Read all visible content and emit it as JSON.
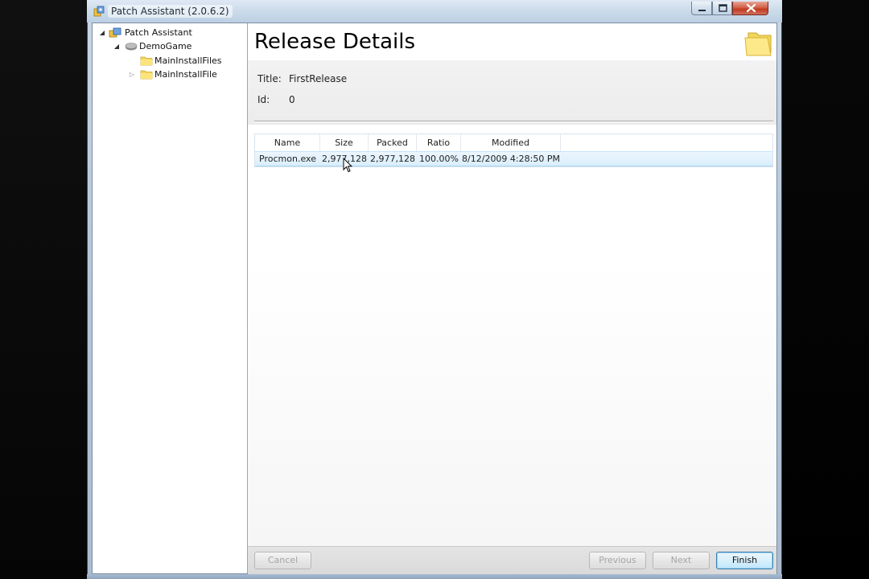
{
  "window": {
    "title": "Patch Assistant (2.0.6.2)"
  },
  "tree": {
    "items": [
      {
        "label": "Patch Assistant",
        "icon": "app-icon",
        "expanded": true
      },
      {
        "label": "DemoGame",
        "icon": "disk-icon",
        "expanded": true
      },
      {
        "label": "MainInstallFiles",
        "icon": "folder-icon"
      },
      {
        "label": "MainInstallFile",
        "icon": "folder-icon",
        "expanded": false
      }
    ]
  },
  "details": {
    "page_title": "Release Details",
    "title_label": "Title:",
    "title_value": "FirstRelease",
    "id_label": "Id:",
    "id_value": "0"
  },
  "grid": {
    "columns": [
      "Name",
      "Size",
      "Packed",
      "Ratio",
      "Modified"
    ],
    "rows": [
      [
        "Procmon.exe",
        "2,977,128",
        "2,977,128",
        "100.00%",
        "8/12/2009 4:28:50 PM"
      ]
    ]
  },
  "buttons": {
    "cancel": "Cancel",
    "previous": "Previous",
    "next": "Next",
    "finish": "Finish"
  },
  "colors": {
    "selection": "#d9eefc",
    "primary_button_border": "#3c7fb1",
    "disabled_text": "#a5a5a5"
  }
}
